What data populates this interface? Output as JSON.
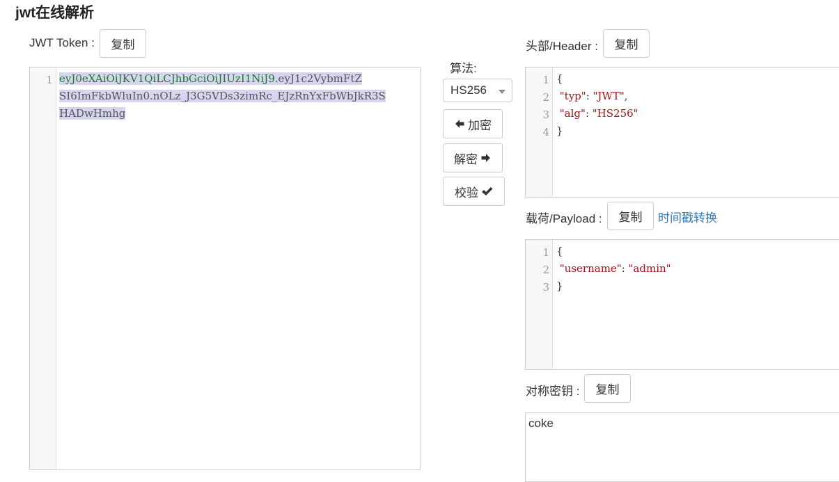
{
  "page_title": "jwt在线解析",
  "token": {
    "label": "JWT Token :",
    "copy_label": "复制",
    "line_number": "1",
    "line1_head": "eyJ0eXAiOiJKV1QiLCJhbGciOiJIUzI1NiJ9.",
    "line1_rest": "eyJ1c2VybmFtZ",
    "line2": "SI6ImFkbWluIn0.nOLz_J3G5VDs3zimRc_EJzRnYxFbWbJkR3S",
    "line3": "HADwHmhg"
  },
  "algorithm": {
    "label": "算法:",
    "selected": "HS256",
    "encrypt_label": "加密",
    "decrypt_label": "解密",
    "verify_label": "校验"
  },
  "header": {
    "label": "头部/Header :",
    "copy_label": "复制",
    "lines": [
      {
        "n": "1",
        "text": "{"
      },
      {
        "n": "2",
        "key": "\"typ\"",
        "val": "\"JWT\"",
        "end": ","
      },
      {
        "n": "3",
        "key": "\"alg\"",
        "val": "\"HS256\"",
        "end": ""
      },
      {
        "n": "4",
        "text": "}"
      }
    ]
  },
  "payload": {
    "label": "载荷/Payload :",
    "copy_label": "复制",
    "timestamp_link": "时间戳转换",
    "lines": [
      {
        "n": "1",
        "text": "{"
      },
      {
        "n": "2",
        "key": "\"username\"",
        "val": "\"admin\"",
        "end": ""
      },
      {
        "n": "3",
        "text": "}"
      }
    ]
  },
  "secret": {
    "label": "对称密钥 :",
    "copy_label": "复制",
    "value": "coke"
  }
}
